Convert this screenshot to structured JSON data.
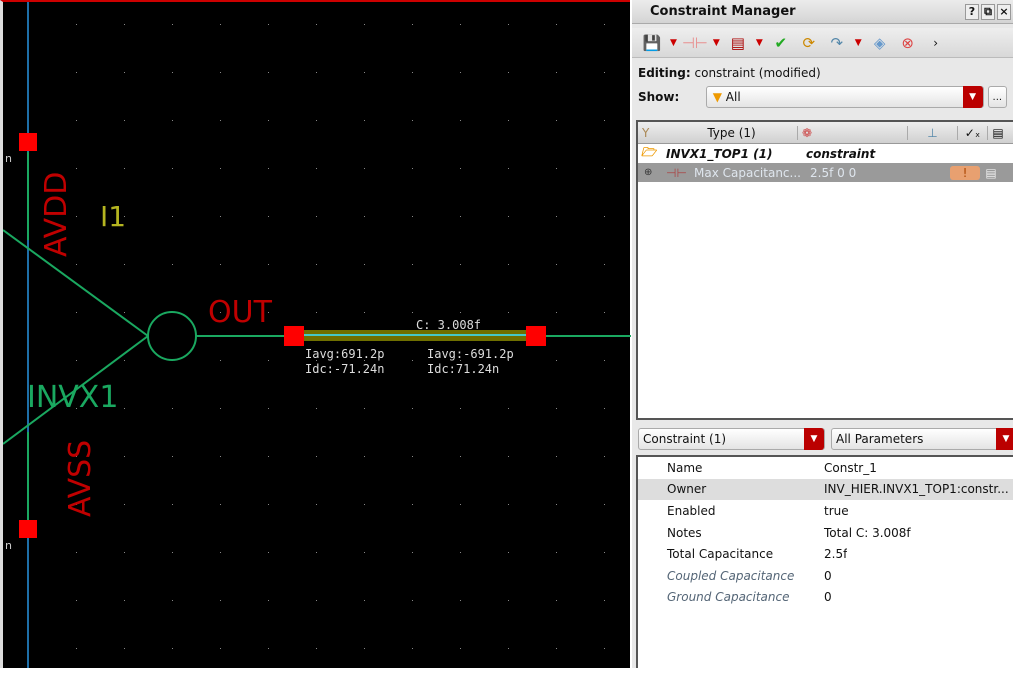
{
  "schematic": {
    "instance_name": "I1",
    "cell_name": "INVX1",
    "pins": {
      "vdd": "AVDD",
      "vss": "AVSS",
      "out": "OUT"
    },
    "edge_labels": [
      "n",
      "n"
    ],
    "net_annotation": {
      "capacitance": "C: 3.008f",
      "left": {
        "iavg": "Iavg:691.2p",
        "idc": "Idc:-71.24n"
      },
      "right": {
        "iavg": "Iavg:-691.2p",
        "idc": "Idc:71.24n"
      }
    },
    "colors": {
      "pin": "#ff0000",
      "wire": "#1aa860",
      "label": "#c00000",
      "instance": "#b5b520",
      "net_highlight": "#7a7a00"
    }
  },
  "panel": {
    "title": "Constraint Manager",
    "title_buttons": [
      "?",
      "⧉",
      "×"
    ],
    "editing_label": "Editing:",
    "editing_value": "constraint (modified)",
    "show_label": "Show:",
    "show_value": "All",
    "more_button": "...",
    "tree": {
      "columns": [
        "Type (1)"
      ],
      "group": {
        "name": "INVX1_TOP1 (1)",
        "type": "constraint"
      },
      "item": {
        "name": "Max Capacitanc...",
        "value": "2.5f 0 0"
      }
    },
    "constraint_select": "Constraint (1)",
    "param_select": "All Parameters",
    "properties": [
      {
        "key": "Name",
        "value": "Constr_1"
      },
      {
        "key": "Owner",
        "value": "INV_HIER.INVX1_TOP1:constr..."
      },
      {
        "key": "Enabled",
        "value": "true"
      },
      {
        "key": "Notes",
        "value": "Total C: 3.008f"
      },
      {
        "key": "Total Capacitance",
        "value": "2.5f"
      },
      {
        "key": "Coupled Capacitance",
        "value": "0"
      },
      {
        "key": "Ground Capacitance",
        "value": "0"
      }
    ]
  }
}
